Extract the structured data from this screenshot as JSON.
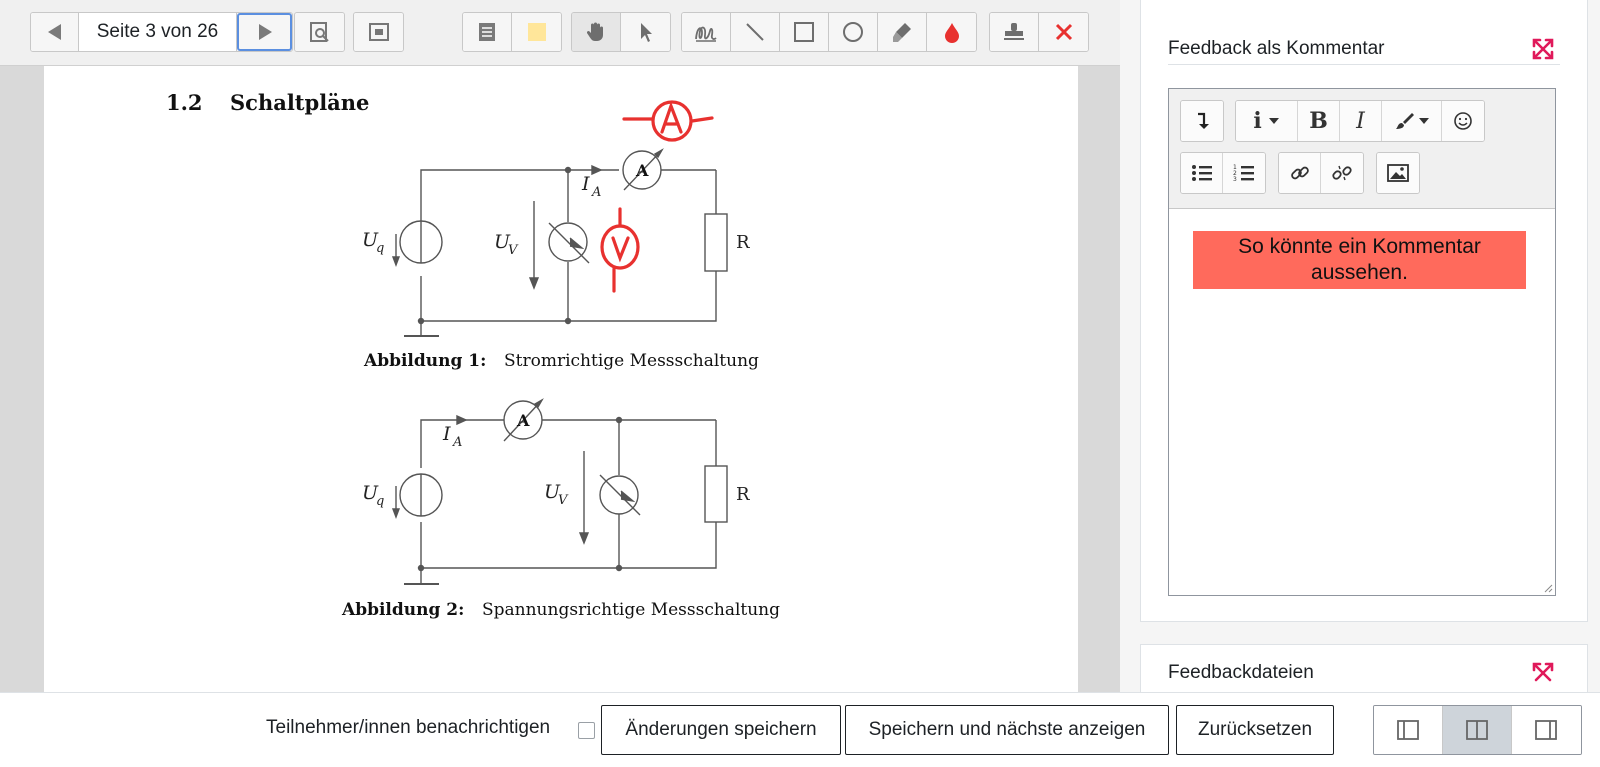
{
  "toolbar": {
    "page_indicator": "Seite 3 von 26",
    "icons": {
      "prev": "triangle-left-icon",
      "next": "triangle-right-icon",
      "search": "search-document-icon",
      "expand": "expand-window-icon",
      "comment": "comment-icon",
      "color": "color-swatch-icon",
      "hand": "hand-icon",
      "pointer": "pointer-icon",
      "pen": "pen-icon",
      "line": "line-icon",
      "rectangle": "rectangle-icon",
      "oval": "oval-icon",
      "highlighter": "highlighter-icon",
      "ink": "ink-drop-icon",
      "stamp": "stamp-icon",
      "delete": "delete-x-icon"
    },
    "colors": {
      "annotation_swatch": "#ffe69a",
      "ink": "#e8312f",
      "delete": "#e8312f",
      "active_border": "#5b8fe0"
    }
  },
  "document": {
    "section_number": "1.2",
    "section_title": "Schaltpläne",
    "fig1": {
      "caption_label": "Abbildung 1:",
      "caption_text": "Stromrichtige Messschaltung",
      "label_uq": "U",
      "label_uq_sub": "q",
      "label_uv": "U",
      "label_uv_sub": "V",
      "label_ia": "I",
      "label_ia_sub": "A",
      "label_r": "R",
      "ammeter": "A"
    },
    "fig2": {
      "caption_label": "Abbildung 2:",
      "caption_text": "Spannungsrichtige Messschaltung",
      "label_uq": "U",
      "label_uq_sub": "q",
      "label_uv": "U",
      "label_uv_sub": "V",
      "label_ia": "I",
      "label_ia_sub": "A",
      "label_r": "R",
      "ammeter": "A"
    },
    "annotation_color": "#e8312f"
  },
  "sidebar": {
    "comment_section": {
      "title": "Feedback als Kommentar",
      "editor_icons": [
        "collapse-toolbar-icon",
        "info-icon",
        "bold-icon",
        "italic-icon",
        "paintbrush-icon",
        "emoji-icon",
        "unordered-list-icon",
        "ordered-list-icon",
        "link-icon",
        "unlink-icon",
        "image-icon"
      ],
      "bold_glyph": "B",
      "italic_glyph": "I",
      "info_glyph": "i",
      "comment_text": "So könnte ein Kommentar aussehen.",
      "comment_bg": "#ff6a5c"
    },
    "files_section": {
      "title": "Feedbackdateien"
    },
    "expand_color": "#e0195a"
  },
  "footer": {
    "notify_label": "Teilnehmer/innen benachrichtigen",
    "save_label": "Änderungen speichern",
    "save_next_label": "Speichern und nächste anzeigen",
    "reset_label": "Zurücksetzen",
    "layout_icons": [
      "layout-left-icon",
      "layout-split-icon",
      "layout-right-icon"
    ]
  }
}
